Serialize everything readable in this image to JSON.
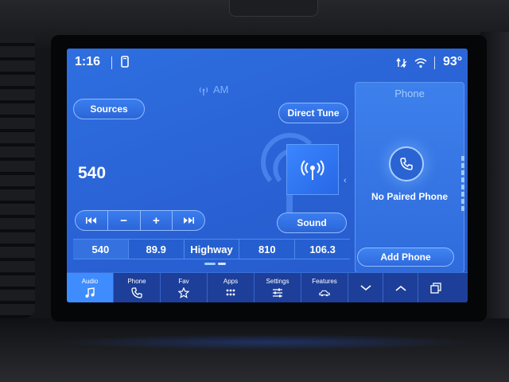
{
  "statusbar": {
    "clock": "1:16",
    "temperature": "93°"
  },
  "audio": {
    "band": "AM",
    "frequency": "540",
    "sources_label": "Sources",
    "direct_tune_label": "Direct Tune",
    "sound_label": "Sound",
    "seek_controls": [
      {
        "name": "seek-back-button",
        "label": ""
      },
      {
        "name": "tune-down-button",
        "label": "−"
      },
      {
        "name": "tune-up-button",
        "label": "+"
      },
      {
        "name": "seek-forward-button",
        "label": ""
      }
    ],
    "presets": [
      {
        "label": "540",
        "active": true
      },
      {
        "label": "89.9",
        "active": false
      },
      {
        "label": "Highway",
        "active": false
      },
      {
        "label": "810",
        "active": false
      },
      {
        "label": "106.3",
        "active": false
      }
    ]
  },
  "phone_panel": {
    "title": "Phone",
    "status": "No Paired Phone",
    "add_phone_label": "Add Phone"
  },
  "navbar": {
    "items": [
      {
        "label": "Audio",
        "icon": "music-note-icon",
        "active": true
      },
      {
        "label": "Phone",
        "icon": "phone-icon",
        "active": false
      },
      {
        "label": "Fav",
        "icon": "star-icon",
        "active": false
      },
      {
        "label": "Apps",
        "icon": "apps-grid-icon",
        "active": false
      },
      {
        "label": "Settings",
        "icon": "sliders-icon",
        "active": false
      },
      {
        "label": "Features",
        "icon": "car-icon",
        "active": false
      }
    ]
  },
  "colors": {
    "screen_blue": "#2a63d6",
    "active_tab": "#3f8cff",
    "nav_bar": "#1d3f99",
    "accent_light": "#8fbaff"
  }
}
